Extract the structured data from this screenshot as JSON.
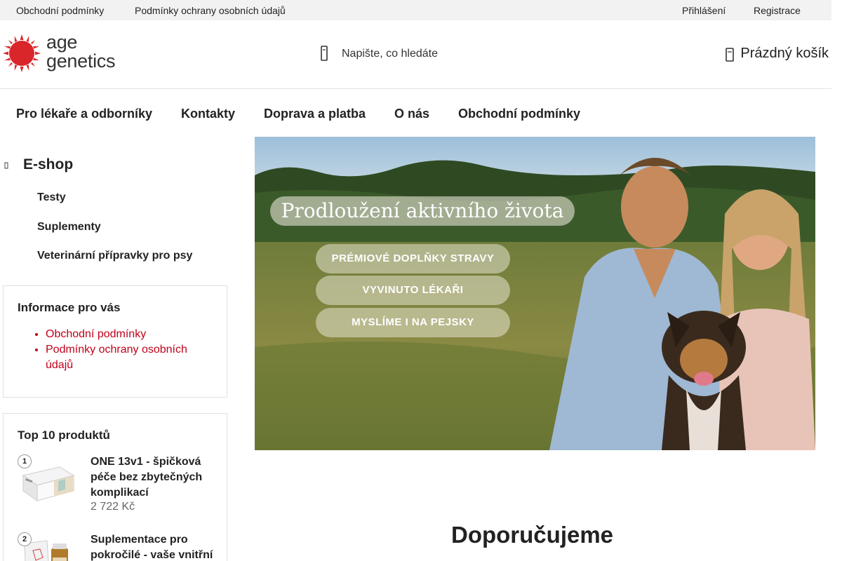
{
  "topbar": {
    "links": [
      "Obchodní podmínky",
      "Podmínky ochrany osobních údajů"
    ],
    "login": "Přihlášení",
    "register": "Registrace"
  },
  "header": {
    "logo": {
      "line1": "age",
      "line2": "genetics",
      "brand_color": "#d9262b"
    },
    "search": {
      "placeholder": "Napište, co hledáte",
      "icon": "search-icon"
    },
    "cart": {
      "label": "Prázdný košík",
      "icon": "cart-icon"
    }
  },
  "mainnav": {
    "items": [
      "Pro lékaře a odborníky",
      "Kontakty",
      "Doprava a platba",
      "O nás",
      "Obchodní podmínky"
    ]
  },
  "sidebar": {
    "eshop_title": "E-shop",
    "categories": [
      "Testy",
      "Suplementy",
      "Veterinární přípravky pro psy"
    ],
    "info": {
      "title": "Informace pro vás",
      "links": [
        "Obchodní podmínky",
        "Podmínky ochrany osobních údajů"
      ]
    },
    "top10": {
      "title": "Top 10 produktů",
      "products": [
        {
          "rank": "1",
          "name": "ONE 13v1 - špičková péče bez zbytečných komplikací",
          "price": "2 722 Kč"
        },
        {
          "rank": "2",
          "name": "Suplementace pro pokročilé - vaše vnitřní",
          "price": ""
        }
      ]
    }
  },
  "banner": {
    "headline": "Prodloužení aktivního života",
    "pills": [
      "PRÉMIOVÉ DOPLŇKY STRAVY",
      "VYVINUTO LÉKAŘI",
      "MYSLÍME I NA PEJSKY"
    ]
  },
  "section": {
    "recommend_title": "Doporučujeme"
  },
  "colors": {
    "accent_link": "#c0001a",
    "topbar_bg": "#f2f2f2"
  }
}
